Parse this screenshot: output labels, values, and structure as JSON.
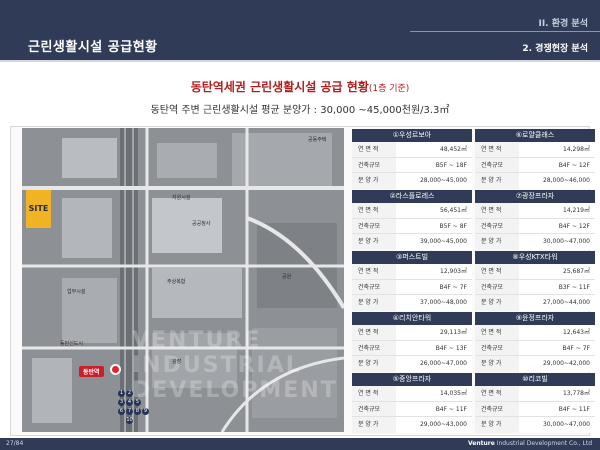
{
  "header": {
    "title": "근린생활시설 공급현황",
    "section_1": "II. 환경 분석",
    "section_2": "2. 경쟁현장 분석"
  },
  "main": {
    "title": "동탄역세권 근린생활시설 공급 현황",
    "title_note": "(1층 기준)",
    "subtitle": "동탄역 주변 근린생활시설 평균 분양가 : 30,000 ~45,000천원/3.3㎡"
  },
  "map": {
    "site_label": "SITE",
    "station_label": "동탄역",
    "watermark": "VENTURE INDUSTRIAL DEVELOPMENT",
    "labels": {
      "top_right": "공동주택",
      "middle_1": "지원시설",
      "middle_2": "공공청사",
      "center": "주상복합",
      "left_mid": "업무시설",
      "bottom_left": "동탄신도시",
      "right_mid": "공원",
      "bottom": "광장"
    },
    "pins": [
      "1",
      "2",
      "3",
      "4",
      "5",
      "6",
      "7",
      "8",
      "9",
      "10"
    ]
  },
  "row_labels": {
    "area": "연 면 적",
    "scale": "건축규모",
    "price": "분 양 가"
  },
  "cards": [
    {
      "title": "①우성르보아",
      "area": "48,452㎡",
      "scale": "B5F ~ 18F",
      "price": "28,000~45,000"
    },
    {
      "title": "⑥로얄클래스",
      "area": "14,298㎡",
      "scale": "B4F ~ 12F",
      "price": "28,000~46,000"
    },
    {
      "title": "②라스플로레스",
      "area": "56,451㎡",
      "scale": "B5F ~ 8F",
      "price": "39,000~45,000"
    },
    {
      "title": "⑦광장프라자",
      "area": "14,219㎡",
      "scale": "B4F ~ 12F",
      "price": "30,000~47,000"
    },
    {
      "title": "③퍼스트빌",
      "area": "12,903㎡",
      "scale": "B4F ~ 7F",
      "price": "37,000~48,000"
    },
    {
      "title": "⑧우성KTX타워",
      "area": "25,687㎡",
      "scale": "B3F ~ 11F",
      "price": "27,000~44,000"
    },
    {
      "title": "④리치안타워",
      "area": "29,113㎡",
      "scale": "B4F ~ 13F",
      "price": "26,000~47,000"
    },
    {
      "title": "⑨윤정프라자",
      "area": "12,643㎡",
      "scale": "B4F ~ 7F",
      "price": "29,000~42,000"
    },
    {
      "title": "⑤중앙프라자",
      "area": "14,035㎡",
      "scale": "B4F ~ 11F",
      "price": "29,000~43,000"
    },
    {
      "title": "⑩리코빌",
      "area": "13,778㎡",
      "scale": "B4F ~ 11F",
      "price": "30,000~47,000"
    }
  ],
  "footer": {
    "page": "27/84",
    "company_bold": "Venture",
    "company_rest": " Industrial Development Co., Ltd"
  }
}
